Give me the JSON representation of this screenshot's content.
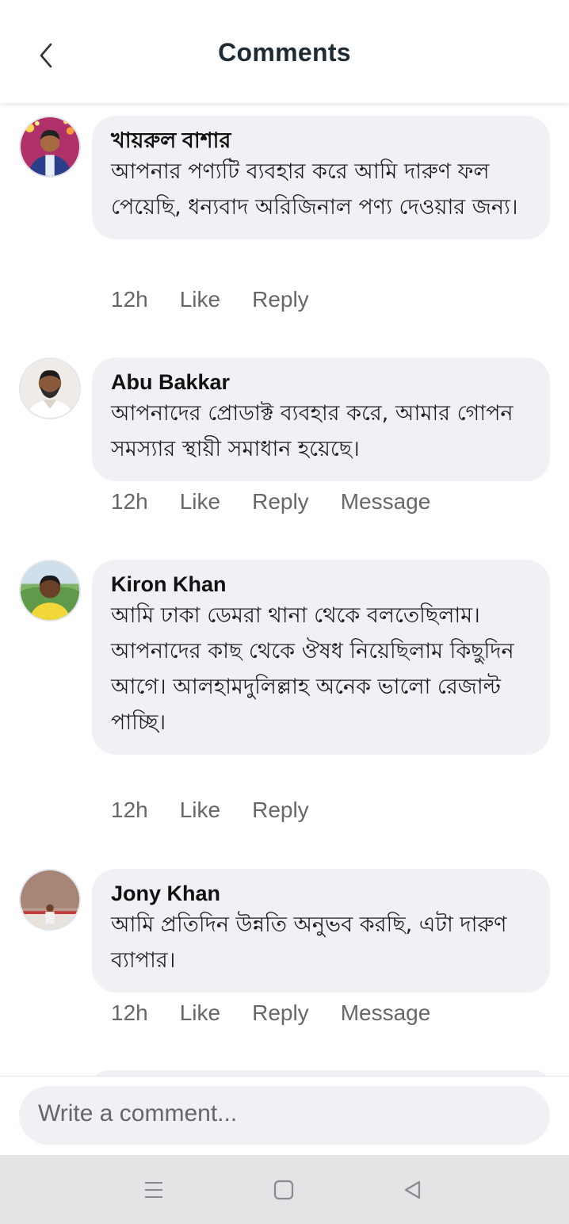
{
  "header": {
    "title": "Comments"
  },
  "comments": [
    {
      "author": "খায়রুল বাশার",
      "text": "আপনার পণ্যটি ব্যবহার করে আমি দারুণ ফল পেয়েছি, ধন্যবাদ অরিজিনাল পণ্য দেওয়ার জন্য।",
      "time": "12h",
      "like": "Like",
      "reply": "Reply",
      "message": ""
    },
    {
      "author": "Abu Bakkar",
      "text": "আপনাদের প্রোডাক্ট ব্যবহার করে, আমার গোপন সমস্যার স্থায়ী সমাধান হয়েছে।",
      "time": "12h",
      "like": "Like",
      "reply": "Reply",
      "message": "Message"
    },
    {
      "author": "Kiron Khan",
      "text": "আমি ঢাকা ডেমরা থানা থেকে বলতেছিলাম। আপনাদের কাছ থেকে ঔষধ নিয়েছিলাম কিছুদিন আগে। আলহামদুলিল্লাহ অনেক ভালো রেজাল্ট পাচ্ছি।",
      "time": "12h",
      "like": "Like",
      "reply": "Reply",
      "message": ""
    },
    {
      "author": "Jony Khan",
      "text": "আমি প্রতিদিন উন্নতি অনুভব করছি, এটা দারুণ ব্যাপার।",
      "time": "12h",
      "like": "Like",
      "reply": "Reply",
      "message": "Message"
    }
  ],
  "composer": {
    "placeholder": "Write a comment..."
  },
  "icons": {
    "back": "chevron-left-icon",
    "nav_recent": "menu-lines-icon",
    "nav_home": "square-icon",
    "nav_back": "triangle-back-icon"
  }
}
